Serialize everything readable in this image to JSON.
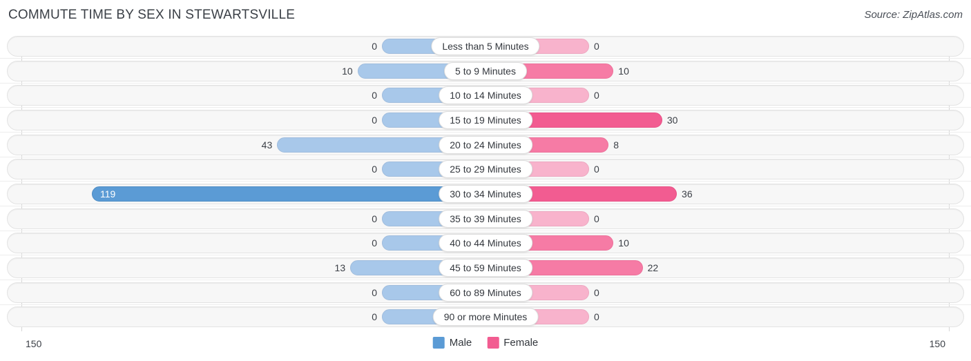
{
  "header": {
    "title": "COMMUTE TIME BY SEX IN STEWARTSVILLE",
    "source": "Source: ZipAtlas.com"
  },
  "footer": {
    "axis_left_label": "150",
    "axis_right_label": "150"
  },
  "legend": {
    "items": [
      {
        "label": "Male",
        "color": "#5b9bd5"
      },
      {
        "label": "Female",
        "color": "#f25c91"
      }
    ]
  },
  "colors": {
    "male_light": "#a8c8ea",
    "male_strong": "#5b9bd5",
    "female_light": "#f8b3cc",
    "female_mid": "#f67ba5",
    "female_strong": "#f25c91",
    "track": "#f7f7f7",
    "title_text": "#3a3f46"
  },
  "chart_data": {
    "type": "bar",
    "subtype": "diverging-bidirectional",
    "title": "COMMUTE TIME BY SEX IN STEWARTSVILLE",
    "xlabel": "",
    "ylabel": "",
    "xlim": [
      150,
      150
    ],
    "axis_max": 150,
    "grid": false,
    "legend_position": "bottom-center",
    "categories": [
      "Less than 5 Minutes",
      "5 to 9 Minutes",
      "10 to 14 Minutes",
      "15 to 19 Minutes",
      "20 to 24 Minutes",
      "25 to 29 Minutes",
      "30 to 34 Minutes",
      "35 to 39 Minutes",
      "40 to 44 Minutes",
      "45 to 59 Minutes",
      "60 to 89 Minutes",
      "90 or more Minutes"
    ],
    "series": [
      {
        "name": "Male",
        "direction": "left",
        "values": [
          0,
          10,
          0,
          0,
          43,
          0,
          119,
          0,
          0,
          13,
          0,
          0
        ]
      },
      {
        "name": "Female",
        "direction": "right",
        "values": [
          0,
          10,
          0,
          30,
          8,
          0,
          36,
          0,
          10,
          22,
          0,
          0
        ]
      }
    ],
    "rows": [
      {
        "category": "Less than 5 Minutes",
        "male": 0,
        "female": 0
      },
      {
        "category": "5 to 9 Minutes",
        "male": 10,
        "female": 10
      },
      {
        "category": "10 to 14 Minutes",
        "male": 0,
        "female": 0
      },
      {
        "category": "15 to 19 Minutes",
        "male": 0,
        "female": 30
      },
      {
        "category": "20 to 24 Minutes",
        "male": 43,
        "female": 8
      },
      {
        "category": "25 to 29 Minutes",
        "male": 0,
        "female": 0
      },
      {
        "category": "30 to 34 Minutes",
        "male": 119,
        "female": 36
      },
      {
        "category": "35 to 39 Minutes",
        "male": 0,
        "female": 0
      },
      {
        "category": "40 to 44 Minutes",
        "male": 0,
        "female": 10
      },
      {
        "category": "45 to 59 Minutes",
        "male": 13,
        "female": 22
      },
      {
        "category": "60 to 89 Minutes",
        "male": 0,
        "female": 0
      },
      {
        "category": "90 or more Minutes",
        "male": 0,
        "female": 0
      }
    ]
  }
}
